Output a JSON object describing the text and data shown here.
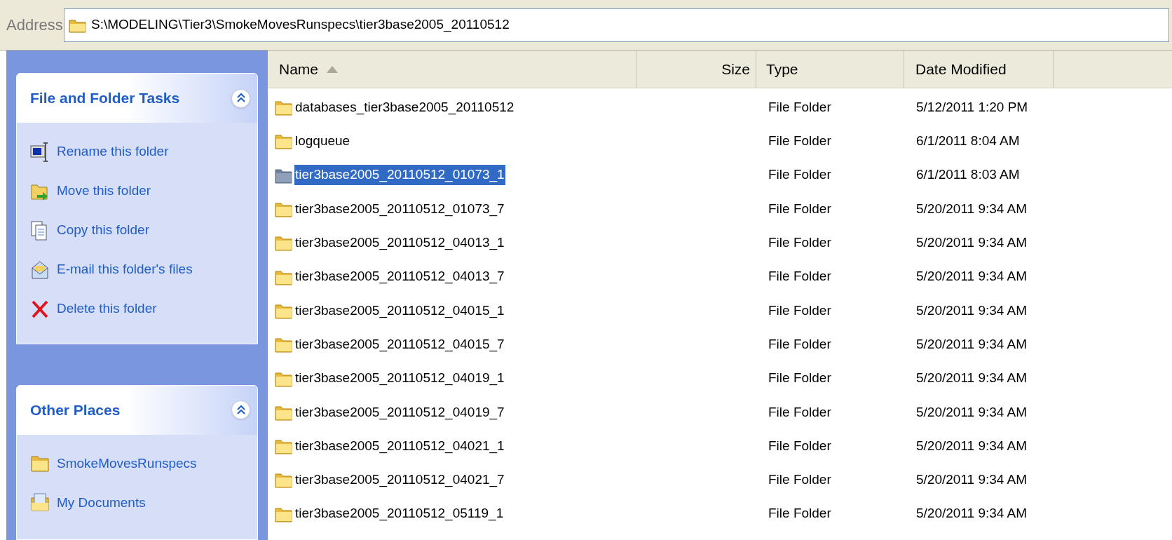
{
  "address": {
    "label": "Address",
    "path": "S:\\MODELING\\Tier3\\SmokeMovesRunspecs\\tier3base2005_20110512"
  },
  "sidebar": {
    "panels": [
      {
        "title": "File and Folder Tasks",
        "expanded": true,
        "items": [
          {
            "label": "Rename this folder",
            "kind": "rename"
          },
          {
            "label": "Move this folder",
            "kind": "move"
          },
          {
            "label": "Copy this folder",
            "kind": "copy"
          },
          {
            "label": "E-mail this folder's files",
            "kind": "email"
          },
          {
            "label": "Delete this folder",
            "kind": "delete"
          }
        ]
      },
      {
        "title": "Other Places",
        "expanded": true,
        "items": [
          {
            "label": "SmokeMovesRunspecs",
            "kind": "folder"
          },
          {
            "label": "My Documents",
            "kind": "documents"
          }
        ]
      }
    ]
  },
  "columns": [
    {
      "label": "Name",
      "sorted": true
    },
    {
      "label": "Size",
      "sorted": false
    },
    {
      "label": "Type",
      "sorted": false
    },
    {
      "label": "Date Modified",
      "sorted": false
    }
  ],
  "rows": [
    {
      "name": "databases_tier3base2005_20110512",
      "type": "File Folder",
      "date": "5/12/2011 1:20 PM",
      "selected": false
    },
    {
      "name": "logqueue",
      "type": "File Folder",
      "date": "6/1/2011 8:04 AM",
      "selected": false
    },
    {
      "name": "tier3base2005_20110512_01073_1",
      "type": "File Folder",
      "date": "6/1/2011 8:03 AM",
      "selected": true
    },
    {
      "name": "tier3base2005_20110512_01073_7",
      "type": "File Folder",
      "date": "5/20/2011 9:34 AM",
      "selected": false
    },
    {
      "name": "tier3base2005_20110512_04013_1",
      "type": "File Folder",
      "date": "5/20/2011 9:34 AM",
      "selected": false
    },
    {
      "name": "tier3base2005_20110512_04013_7",
      "type": "File Folder",
      "date": "5/20/2011 9:34 AM",
      "selected": false
    },
    {
      "name": "tier3base2005_20110512_04015_1",
      "type": "File Folder",
      "date": "5/20/2011 9:34 AM",
      "selected": false
    },
    {
      "name": "tier3base2005_20110512_04015_7",
      "type": "File Folder",
      "date": "5/20/2011 9:34 AM",
      "selected": false
    },
    {
      "name": "tier3base2005_20110512_04019_1",
      "type": "File Folder",
      "date": "5/20/2011 9:34 AM",
      "selected": false
    },
    {
      "name": "tier3base2005_20110512_04019_7",
      "type": "File Folder",
      "date": "5/20/2011 9:34 AM",
      "selected": false
    },
    {
      "name": "tier3base2005_20110512_04021_1",
      "type": "File Folder",
      "date": "5/20/2011 9:34 AM",
      "selected": false
    },
    {
      "name": "tier3base2005_20110512_04021_7",
      "type": "File Folder",
      "date": "5/20/2011 9:34 AM",
      "selected": false
    },
    {
      "name": "tier3base2005_20110512_05119_1",
      "type": "File Folder",
      "date": "5/20/2011 9:34 AM",
      "selected": false
    }
  ]
}
